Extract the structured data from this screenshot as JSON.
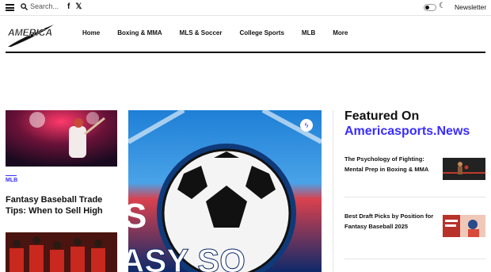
{
  "topbar": {
    "search_placeholder": "Search...",
    "social": [
      "f",
      "𝕏"
    ],
    "newsletter": "Newsletter"
  },
  "logo": {
    "text": "AMERICA"
  },
  "nav": [
    "Home",
    "Boxing & MMA",
    "MLS & Soccer",
    "College Sports",
    "MLB",
    "More"
  ],
  "left": {
    "category": "MLB",
    "headline": "Fantasy Baseball Trade Tips: When to Sell High"
  },
  "center": {
    "overlay": "ASY SO",
    "overlay_top": "S"
  },
  "featured": {
    "title_line1": "Featured On",
    "title_line2": "Americasports.News",
    "items": [
      "The Psychology of Fighting: Mental Prep in Boxing & MMA",
      "Best Draft Picks by Position for Fantasy Baseball 2025"
    ]
  },
  "colors": {
    "accent": "#3a2cff",
    "text": "#111111"
  }
}
